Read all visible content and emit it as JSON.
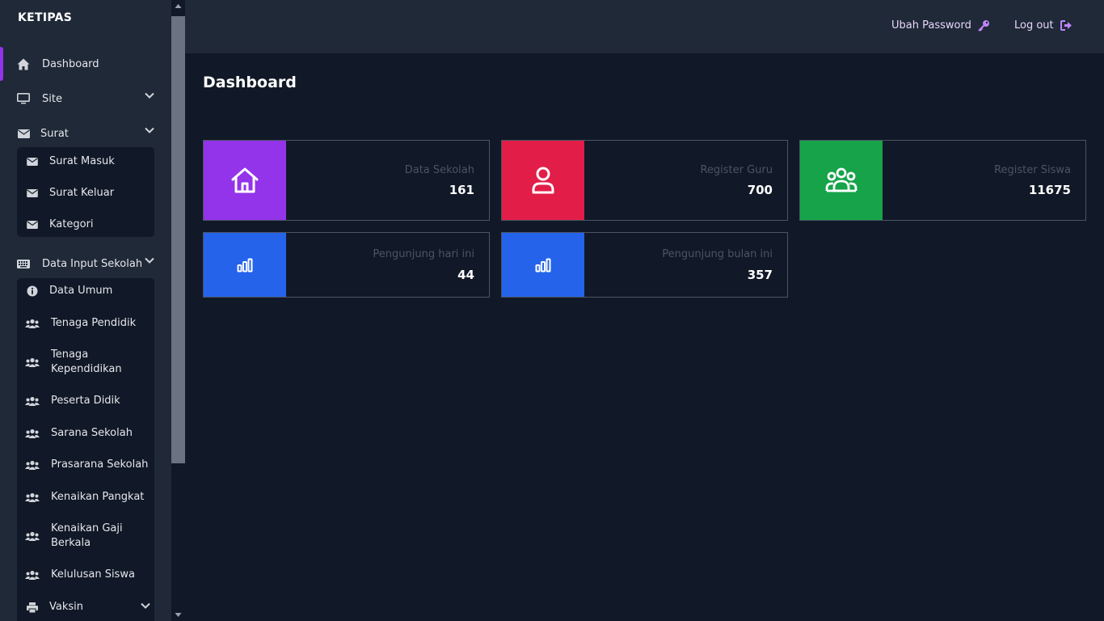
{
  "app": {
    "brand": "KETIPAS"
  },
  "header": {
    "change_password": "Ubah Password",
    "logout": "Log out"
  },
  "page": {
    "title": "Dashboard"
  },
  "sidebar": {
    "dashboard": "Dashboard",
    "site": "Site",
    "surat": "Surat",
    "surat_items": [
      "Surat Masuk",
      "Surat Keluar",
      "Kategori"
    ],
    "data_input": "Data Input Sekolah",
    "data_input_items": [
      "Data Umum",
      "Tenaga Pendidik",
      "Tenaga Kependidikan",
      "Peserta Didik",
      "Sarana Sekolah",
      "Prasarana Sekolah",
      "Kenaikan Pangkat",
      "Kenaikan Gaji Berkala",
      "Kelulusan Siswa",
      "Vaksin"
    ]
  },
  "cards": [
    {
      "label": "Data Sekolah",
      "value": "161",
      "color": "#9333ea",
      "icon": "home-icon"
    },
    {
      "label": "Register Guru",
      "value": "700",
      "color": "#e11d48",
      "icon": "user-icon"
    },
    {
      "label": "Register Siswa",
      "value": "11675",
      "color": "#16a34a",
      "icon": "users-group-icon"
    },
    {
      "label": "Pengunjung hari ini",
      "value": "44",
      "color": "#2563eb",
      "icon": "bar-chart-icon"
    },
    {
      "label": "Pengunjung bulan ini",
      "value": "357",
      "color": "#2563eb",
      "icon": "bar-chart-icon"
    }
  ],
  "colors": {
    "accent": "#9333ea",
    "sidebar_bg": "#1f2937",
    "page_bg": "#111827"
  }
}
